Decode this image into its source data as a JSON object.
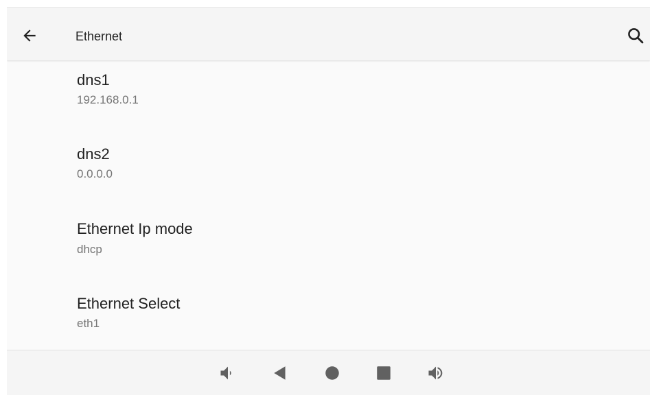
{
  "app_bar": {
    "title": "Ethernet",
    "back_icon": "arrow-back-icon",
    "search_icon": "search-icon"
  },
  "preferences": [
    {
      "title": "dns1",
      "summary": "192.168.0.1"
    },
    {
      "title": "dns2",
      "summary": "0.0.0.0"
    },
    {
      "title": "Ethernet Ip mode",
      "summary": "dhcp"
    },
    {
      "title": "Ethernet Select",
      "summary": "eth1"
    }
  ],
  "nav_bar": {
    "buttons": [
      "volume-down-icon",
      "back-triangle-icon",
      "home-circle-icon",
      "recents-square-icon",
      "volume-up-icon"
    ]
  },
  "colors": {
    "bar_background": "#f5f5f5",
    "page_background": "#fafafa",
    "primary_text": "#212121",
    "secondary_text": "#757575",
    "nav_icon": "#616161"
  }
}
